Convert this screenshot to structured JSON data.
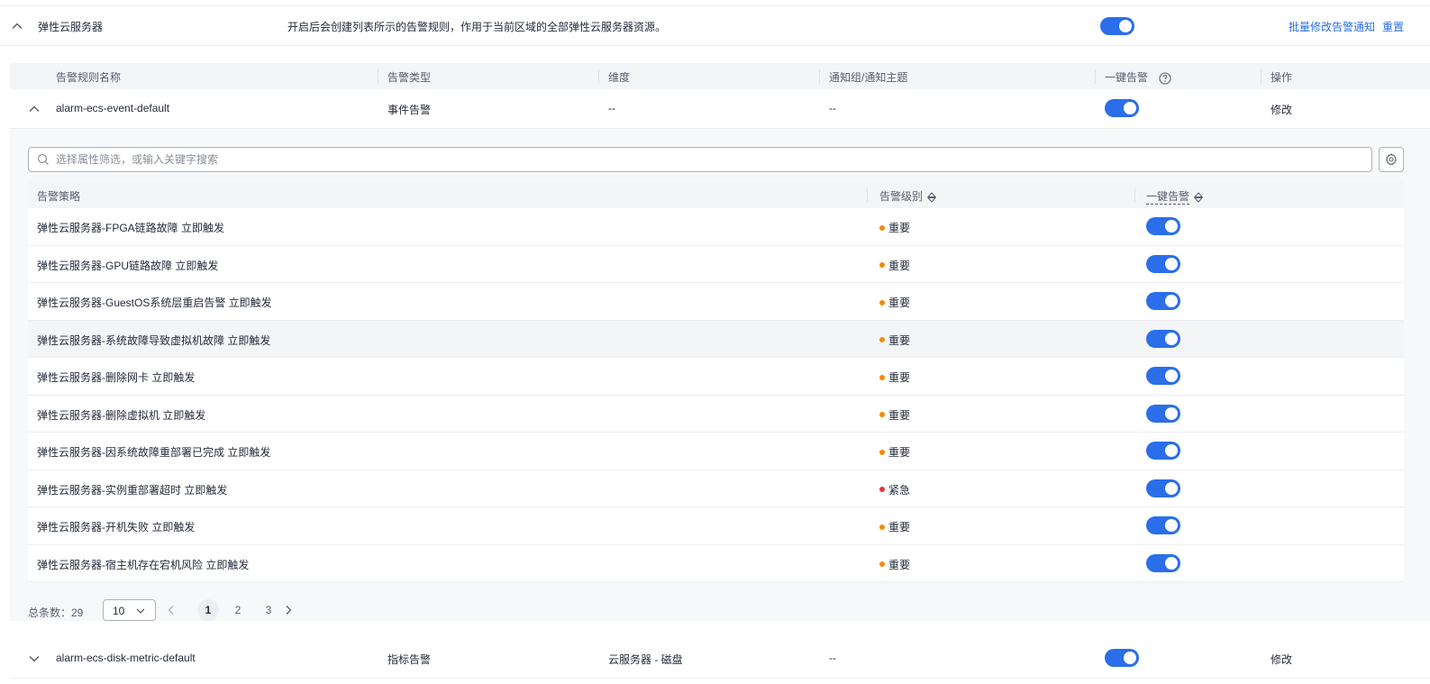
{
  "section": {
    "title": "弹性云服务器",
    "description": "开启后会创建列表所示的告警规则，作用于当前区域的全部弹性云服务器资源。",
    "enabled": true,
    "batch_edit_label": "批量修改告警通知",
    "reset_label": "重置"
  },
  "rule_table": {
    "headers": {
      "name": "告警规则名称",
      "type": "告警类型",
      "dimension": "维度",
      "notify": "通知组/通知主题",
      "one_click": "一键告警",
      "action": "操作"
    },
    "rows": [
      {
        "name": "alarm-ecs-event-default",
        "type": "事件告警",
        "dimension": "--",
        "notify": "--",
        "enabled": true,
        "action": "修改"
      },
      {
        "name": "alarm-ecs-disk-metric-default",
        "type": "指标告警",
        "dimension": "云服务器 - 磁盘",
        "notify": "--",
        "enabled": true,
        "action": "修改"
      }
    ]
  },
  "search": {
    "placeholder": "选择属性筛选，或输入关键字搜索"
  },
  "policy_table": {
    "headers": {
      "policy": "告警策略",
      "level": "告警级别",
      "one_click": "一键告警"
    },
    "rows": [
      {
        "policy": "弹性云服务器-FPGA链路故障 立即触发",
        "level": "重要",
        "level_color": "#f28b00",
        "enabled": true
      },
      {
        "policy": "弹性云服务器-GPU链路故障 立即触发",
        "level": "重要",
        "level_color": "#f28b00",
        "enabled": true
      },
      {
        "policy": "弹性云服务器-GuestOS系统层重启告警 立即触发",
        "level": "重要",
        "level_color": "#f28b00",
        "enabled": true
      },
      {
        "policy": "弹性云服务器-系统故障导致虚拟机故障 立即触发",
        "level": "重要",
        "level_color": "#f28b00",
        "enabled": true
      },
      {
        "policy": "弹性云服务器-删除网卡 立即触发",
        "level": "重要",
        "level_color": "#f28b00",
        "enabled": true
      },
      {
        "policy": "弹性云服务器-删除虚拟机 立即触发",
        "level": "重要",
        "level_color": "#f28b00",
        "enabled": true
      },
      {
        "policy": "弹性云服务器-因系统故障重部署已完成 立即触发",
        "level": "重要",
        "level_color": "#f28b00",
        "enabled": true
      },
      {
        "policy": "弹性云服务器-实例重部署超时 立即触发",
        "level": "紧急",
        "level_color": "#e8333a",
        "enabled": true
      },
      {
        "policy": "弹性云服务器-开机失败 立即触发",
        "level": "重要",
        "level_color": "#f28b00",
        "enabled": true
      },
      {
        "policy": "弹性云服务器-宿主机存在宕机风险 立即触发",
        "level": "重要",
        "level_color": "#f28b00",
        "enabled": true
      }
    ]
  },
  "pagination": {
    "total_label": "总条数：29",
    "page_size": "10",
    "pages": [
      "1",
      "2",
      "3"
    ],
    "current_page": "1"
  },
  "colors": {
    "accent": "#2a6ee9",
    "important": "#f28b00",
    "urgent": "#e8333a"
  }
}
